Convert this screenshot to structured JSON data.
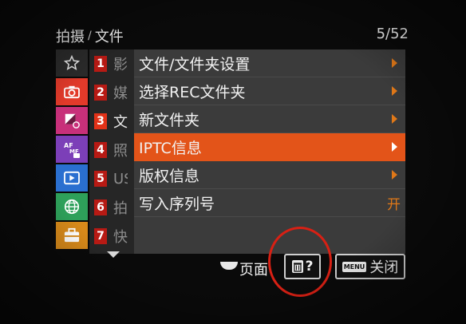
{
  "header": {
    "breadcrumb_tab": "拍摄",
    "breadcrumb_separator": "/",
    "breadcrumb_section": "文件",
    "page_indicator": "5/52"
  },
  "left_tabs": [
    {
      "icon": "star-icon",
      "color": "#2b2b2b"
    },
    {
      "icon": "camera-icon",
      "color": "#e23a2a"
    },
    {
      "icon": "exposure-icon",
      "color": "#c8307a"
    },
    {
      "icon": "af-mf-icon",
      "color": "#7c3fb8"
    },
    {
      "icon": "playback-icon",
      "color": "#2a6fd0"
    },
    {
      "icon": "network-icon",
      "color": "#2ea05a"
    },
    {
      "icon": "toolbox-icon",
      "color": "#d88a1a"
    }
  ],
  "sub_pages": [
    {
      "num": "1",
      "label": "影"
    },
    {
      "num": "2",
      "label": "媒"
    },
    {
      "num": "3",
      "label": "文"
    },
    {
      "num": "4",
      "label": "照"
    },
    {
      "num": "5",
      "label": "US"
    },
    {
      "num": "6",
      "label": "拍"
    },
    {
      "num": "7",
      "label": "快"
    }
  ],
  "menu": {
    "items": [
      {
        "label": "文件/文件夹设置",
        "type": "arrow"
      },
      {
        "label": "选择REC文件夹",
        "type": "arrow"
      },
      {
        "label": "新文件夹",
        "type": "arrow"
      },
      {
        "label": "IPTC信息",
        "type": "arrow"
      },
      {
        "label": "版权信息",
        "type": "arrow"
      },
      {
        "label": "写入序列号",
        "type": "value",
        "value": "开"
      }
    ]
  },
  "footer": {
    "page_label": "页面",
    "help_label": "?",
    "menu_key": "MENU",
    "close_label": "关闭"
  },
  "colors": {
    "selection": "#e35419",
    "accent_arrow": "#e07818",
    "badge": "#b71a14",
    "annotation_circle": "#d82014"
  }
}
